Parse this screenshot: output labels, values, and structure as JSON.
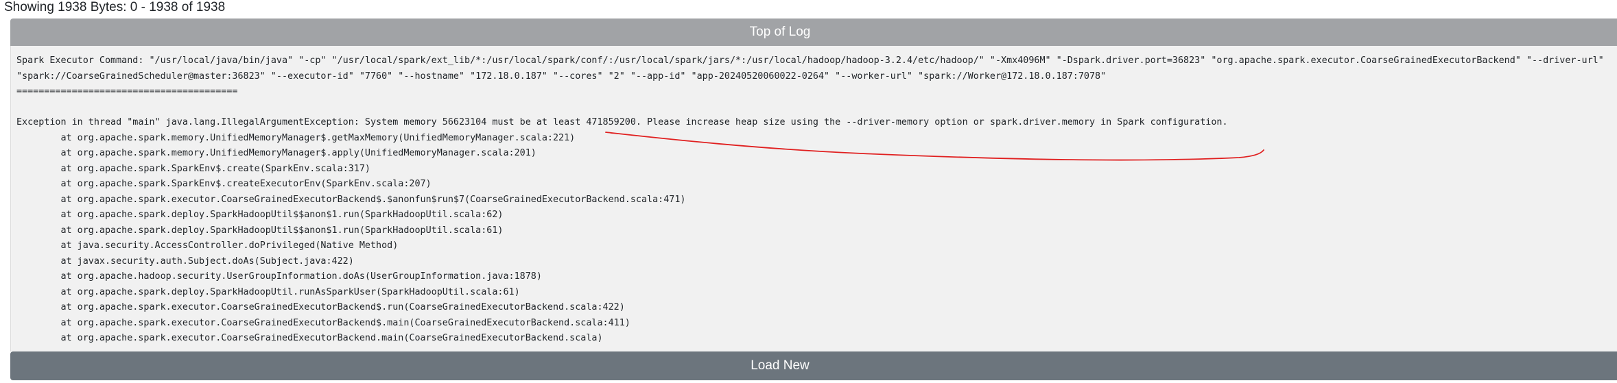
{
  "header": {
    "showing_text": "Showing 1938 Bytes: 0 - 1938 of 1938"
  },
  "buttons": {
    "top_label": "Top of Log",
    "load_label": "Load New"
  },
  "log": {
    "lines": [
      "Spark Executor Command: \"/usr/local/java/bin/java\" \"-cp\" \"/usr/local/spark/ext_lib/*:/usr/local/spark/conf/:/usr/local/spark/jars/*:/usr/local/hadoop/hadoop-3.2.4/etc/hadoop/\" \"-Xmx4096M\" \"-Dspark.driver.port=36823\" \"org.apache.spark.executor.CoarseGrainedExecutorBackend\" \"--driver-url\"",
      "\"spark://CoarseGrainedScheduler@master:36823\" \"--executor-id\" \"7760\" \"--hostname\" \"172.18.0.187\" \"--cores\" \"2\" \"--app-id\" \"app-20240520060022-0264\" \"--worker-url\" \"spark://Worker@172.18.0.187:7078\"",
      "========================================",
      "",
      "Exception in thread \"main\" java.lang.IllegalArgumentException: System memory 56623104 must be at least 471859200. Please increase heap size using the --driver-memory option or spark.driver.memory in Spark configuration.",
      "\tat org.apache.spark.memory.UnifiedMemoryManager$.getMaxMemory(UnifiedMemoryManager.scala:221)",
      "\tat org.apache.spark.memory.UnifiedMemoryManager$.apply(UnifiedMemoryManager.scala:201)",
      "\tat org.apache.spark.SparkEnv$.create(SparkEnv.scala:317)",
      "\tat org.apache.spark.SparkEnv$.createExecutorEnv(SparkEnv.scala:207)",
      "\tat org.apache.spark.executor.CoarseGrainedExecutorBackend$.$anonfun$run$7(CoarseGrainedExecutorBackend.scala:471)",
      "\tat org.apache.spark.deploy.SparkHadoopUtil$$anon$1.run(SparkHadoopUtil.scala:62)",
      "\tat org.apache.spark.deploy.SparkHadoopUtil$$anon$1.run(SparkHadoopUtil.scala:61)",
      "\tat java.security.AccessController.doPrivileged(Native Method)",
      "\tat javax.security.auth.Subject.doAs(Subject.java:422)",
      "\tat org.apache.hadoop.security.UserGroupInformation.doAs(UserGroupInformation.java:1878)",
      "\tat org.apache.spark.deploy.SparkHadoopUtil.runAsSparkUser(SparkHadoopUtil.scala:61)",
      "\tat org.apache.spark.executor.CoarseGrainedExecutorBackend$.run(CoarseGrainedExecutorBackend.scala:422)",
      "\tat org.apache.spark.executor.CoarseGrainedExecutorBackend$.main(CoarseGrainedExecutorBackend.scala:411)",
      "\tat org.apache.spark.executor.CoarseGrainedExecutorBackend.main(CoarseGrainedExecutorBackend.scala)"
    ]
  },
  "colors": {
    "top_button_bg": "#a1a3a6",
    "load_button_bg": "#6c757d",
    "log_bg": "#f1f1f1",
    "annotation": "#e02020"
  }
}
